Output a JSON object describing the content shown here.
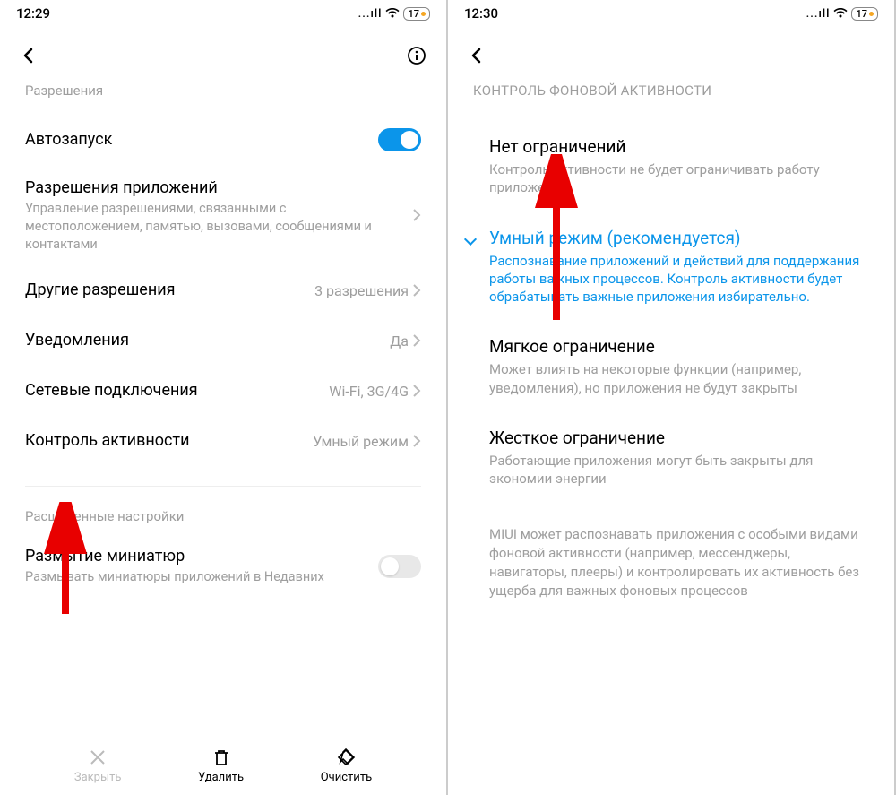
{
  "left": {
    "status": {
      "time": "12:29",
      "signal": "...ıll",
      "battery": "17"
    },
    "section_header": "Разрешения",
    "rows": {
      "autostart": {
        "title": "Автозапуск"
      },
      "app_permissions": {
        "title": "Разрешения приложений",
        "desc": "Управление разрешениями, связанными с местоположением, памятью, вызовами, сообщениями и контактами"
      },
      "other_permissions": {
        "title": "Другие разрешения",
        "value": "3 разрешения"
      },
      "notifications": {
        "title": "Уведомления",
        "value": "Да"
      },
      "network": {
        "title": "Сетевые подключения",
        "value": "Wi-Fi, 3G/4G"
      },
      "activity": {
        "title": "Контроль активности",
        "value": "Умный режим"
      }
    },
    "advanced_header": "Расширенные настройки",
    "blur": {
      "title": "Размытие миниатюр",
      "desc": "Размывать миниатюры приложений в Недавних"
    },
    "bottom": {
      "close": "Закрыть",
      "delete": "Удалить",
      "clear": "Очистить"
    }
  },
  "right": {
    "status": {
      "time": "12:30",
      "signal": "...ıll",
      "battery": "17"
    },
    "section_header": "КОНТРОЛЬ ФОНОВОЙ АКТИВНОСТИ",
    "options": {
      "none": {
        "title": "Нет ограничений",
        "desc": "Контроль активности не будет ограничивать работу приложений"
      },
      "smart": {
        "title": "Умный режим (рекомендуется)",
        "desc": "Распознавание приложений и действий для поддержания работы важных процессов. Контроль активности будет обрабатывать важные приложения избирательно."
      },
      "soft": {
        "title": "Мягкое ограничение",
        "desc": "Может влиять на некоторые функции (например, уведомления), но приложения не будут закрыты"
      },
      "hard": {
        "title": "Жесткое ограничение",
        "desc": "Работающие приложения могут быть закрыты для экономии энергии"
      }
    },
    "footnote": "MIUI может распознавать приложения с особыми видами фоновой активности (например, мессенджеры, навигаторы, плееры) и контролировать их активность без ущерба для важных фоновых процессов"
  }
}
